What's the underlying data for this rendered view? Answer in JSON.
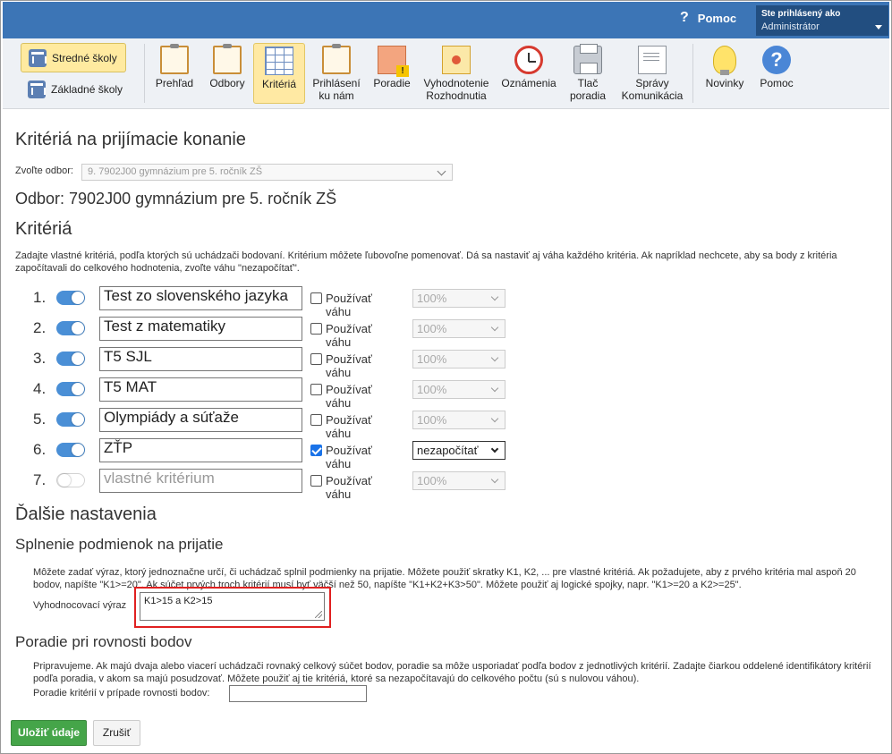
{
  "topbar": {
    "help_label": "Pomoc",
    "user_line1": "Ste prihlásený ako",
    "user_line2": "Administrátor"
  },
  "schools": {
    "stredne": "Stredné školy",
    "zakladne": "Základné školy"
  },
  "toolbar": {
    "items": [
      {
        "label": "Prehľad",
        "icon": "clipboard-eye-icon"
      },
      {
        "label": "Odbory",
        "icon": "clipboard-search-icon"
      },
      {
        "label": "Kritériá",
        "icon": "table-grid-icon"
      },
      {
        "label": "Prihlásení\nku nám",
        "icon": "clipboard-check-icon"
      },
      {
        "label": "Poradie",
        "icon": "document-warning-icon"
      },
      {
        "label": "Vyhodnotenie\nRozhodnutia",
        "icon": "certificate-icon"
      },
      {
        "label": "Oznámenia",
        "icon": "clock-history-icon"
      },
      {
        "label": "Tlač\nporadia",
        "icon": "printer-icon"
      },
      {
        "label": "Správy\nKomunikácia",
        "icon": "page-lines-icon"
      },
      {
        "label": "Novinky",
        "icon": "lightbulb-icon"
      },
      {
        "label": "Pomoc",
        "icon": "help-circle-icon"
      }
    ]
  },
  "page": {
    "title": "Kritériá na prijímacie konanie",
    "odbor_label": "Zvoľte odbor:",
    "odbor_selected": "9. 7902J00 gymnázium pre 5. ročník ZŠ",
    "odbor_heading": "Odbor: 7902J00 gymnázium pre 5. ročník ZŠ",
    "kriteria_heading": "Kritériá",
    "kriteria_desc": "Zadajte vlastné kritériá, podľa ktorých sú uchádzači bodovaní. Kritérium môžete ľubovoľne pomenovať. Dá sa nastaviť aj váha každého kritéria. Ak napríklad nechcete, aby sa body z kritéria započítavali do celkového hodnotenia, zvoľte váhu \"nezapočítať\"."
  },
  "criteria": [
    {
      "num": "1.",
      "enabled": true,
      "name": "Test zo slovenského jazyka",
      "use_weight": false,
      "weight": "100%"
    },
    {
      "num": "2.",
      "enabled": true,
      "name": "Test z matematiky",
      "use_weight": false,
      "weight": "100%"
    },
    {
      "num": "3.",
      "enabled": true,
      "name": "T5 SJL",
      "use_weight": false,
      "weight": "100%"
    },
    {
      "num": "4.",
      "enabled": true,
      "name": "T5 MAT",
      "use_weight": false,
      "weight": "100%"
    },
    {
      "num": "5.",
      "enabled": true,
      "name": "Olympiády a súťaže",
      "use_weight": false,
      "weight": "100%"
    },
    {
      "num": "6.",
      "enabled": true,
      "name": "ZŤP",
      "use_weight": true,
      "weight": "nezapočítať"
    },
    {
      "num": "7.",
      "enabled": false,
      "name": "",
      "placeholder": "vlastné kritérium",
      "use_weight": false,
      "weight": "100%"
    }
  ],
  "weight_label": "Používať váhu",
  "extra": {
    "heading": "Ďalšie nastavenia",
    "conditions_heading": "Splnenie podmienok na prijatie",
    "conditions_desc": "Môžete zadať výraz, ktorý jednoznačne určí, či uchádzač splnil podmienky na prijatie. Môžete použiť skratky K1, K2, ... pre vlastné kritériá. Ak požadujete, aby z prvého kritéria mal aspoň 20 bodov, napíšte \"K1>=20\". Ak súčet prvých troch kritérií musí byť väčší než 50, napíšte \"K1+K2+K3>50\". Môžete použiť aj logické spojky, napr. \"K1>=20 a K2>=25\".",
    "expr_label": "Vyhodnocovací výraz",
    "expr_value": "K1>15 a K2>15",
    "tie_heading": "Poradie pri rovnosti bodov",
    "tie_desc": "Pripravujeme. Ak majú dvaja alebo viacerí uchádzači rovnaký celkový súčet bodov, poradie sa môže usporiadať podľa bodov z jednotlivých kritérií. Zadajte čiarkou oddelené identifikátory kritérií podľa poradia, v akom sa majú posudzovať. Môžete použiť aj tie kritériá, ktoré sa nezapočítavajú do celkového počtu (sú s nulovou váhou).",
    "tie_label": "Poradie kritérií v prípade rovnosti bodov:",
    "tie_value": ""
  },
  "actions": {
    "save": "Uložiť údaje",
    "cancel": "Zrušiť"
  },
  "colors": {
    "topbar": "#3c75b6",
    "active_tool": "#ffe9a3",
    "save_button": "#45a549",
    "highlight_box": "#e02020"
  }
}
